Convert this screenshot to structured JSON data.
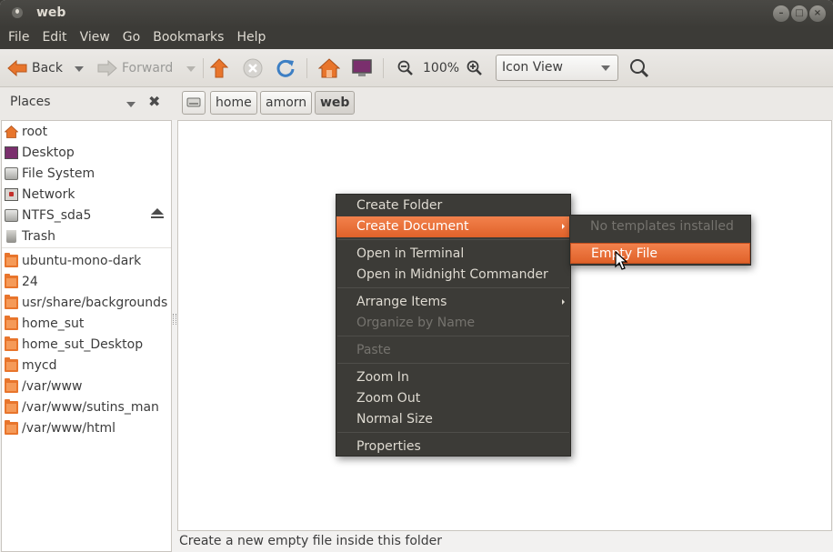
{
  "window": {
    "title": "web"
  },
  "menubar": {
    "items": [
      "File",
      "Edit",
      "View",
      "Go",
      "Bookmarks",
      "Help"
    ]
  },
  "toolbar": {
    "back_label": "Back",
    "forward_label": "Forward",
    "zoom_level": "100%",
    "view_mode": "Icon View"
  },
  "locationbar": {
    "places_label": "Places",
    "breadcrumbs": [
      "home",
      "amorn",
      "web"
    ]
  },
  "sidebar": {
    "devices": [
      "root",
      "Desktop",
      "File System",
      "Network",
      "NTFS_sda5",
      "Trash"
    ],
    "bookmarks": [
      "ubuntu-mono-dark",
      "24",
      "usr/share/backgrounds",
      "home_sut",
      "home_sut_Desktop",
      "mycd",
      "/var/www",
      "/var/www/sutins_man",
      "/var/www/html"
    ]
  },
  "context_menu": {
    "items": [
      "Create Folder",
      "Create Document",
      "Open in Terminal",
      "Open in Midnight Commander",
      "Arrange Items",
      "Organize by Name",
      "Paste",
      "Zoom In",
      "Zoom Out",
      "Normal Size",
      "Properties"
    ]
  },
  "submenu": {
    "items": [
      "No templates installed",
      "Empty File"
    ]
  },
  "status": {
    "text": "Create a new empty file inside this folder"
  },
  "colors": {
    "accent": "#f07746",
    "menu_bg": "#3c3b37",
    "folder": "#e8752c"
  }
}
